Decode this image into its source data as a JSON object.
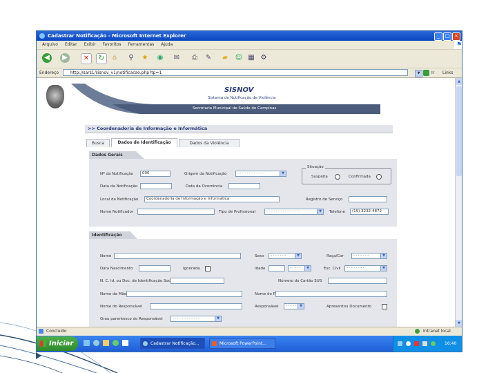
{
  "window": {
    "title": "Cadastrar Notificação - Microsoft Internet Explorer"
  },
  "menu": [
    "Arquivo",
    "Editar",
    "Exibir",
    "Favoritos",
    "Ferramentas",
    "Ajuda"
  ],
  "toolbar": {
    "icons": [
      "back-icon",
      "forward-icon",
      "stop-icon",
      "refresh-icon",
      "home-icon",
      "search-icon",
      "favorites-icon",
      "history-icon",
      "mail-icon",
      "print-icon",
      "edit-icon",
      "folder-icon",
      "messenger-icon",
      "research-icon",
      "tools-icon"
    ]
  },
  "address": {
    "label": "Endereço",
    "url": "http://sars1/sisnov_v1/notificacao.php?tp=1",
    "go_label": "Ir",
    "links_label": "Links"
  },
  "header": {
    "app_name": "SISNOV",
    "subtitle1": "Sistema de Notificação de Violência",
    "subtitle2": "Secretaria Municipal de Saúde de Campinas"
  },
  "page": {
    "section_title": ">> Coordenadoria de Informação e Informática"
  },
  "tabs": [
    "Busca",
    "Dados de Identificação",
    "Dados da Violência"
  ],
  "dados_gerais": {
    "title": "Dados Gerais",
    "n_notificacao_label": "Nº da Notificação",
    "n_notificacao_value": "000",
    "origem_label": "Origem da Notificação",
    "origem_value": "- - - - - - - - - - - -",
    "situacao_label": "Situação",
    "suspeita_label": "Suspeita",
    "confirmada_label": "Confirmada",
    "data_notificacao_label": "Data da Notificação",
    "data_ocorrencia_label": "Data da Ocorrência",
    "local_label": "Local da Notificação",
    "local_value": "Coordenadoria de Informação e Informática",
    "registro_label": "Registro de Serviço",
    "nome_notificador_label": "Nome Notificador",
    "tipo_label": "Tipo de Profissional",
    "tipo_value": "- - - - - - - - - - - - - - -",
    "telefone_label": "Telefone",
    "telefone_value": "(19) 3232-4872"
  },
  "identificacao": {
    "title": "Identificação",
    "nome_label": "Nome",
    "sexo_label": "Sexo",
    "sexo_value": "- - - - - - -",
    "raca_label": "Raça/Cor",
    "raca_value": "- - - - - - -",
    "nascimento_label": "Data Nascimento",
    "ignorada_label": "Ignorada",
    "idade_label": "Idade",
    "idade_unit_value": "- - - - -",
    "escolaridade_label": "Esc. Civil",
    "escolaridade_value": "- - - - - - - -",
    "doc_label": "N. C. Id. ou Doc. de Identificação Social",
    "cartao_sus_label": "Número do Cartão SUS",
    "mae_label": "Nome da Mãe",
    "pai_label": "Nome do Pai",
    "responsavel_label": "Nome do Responsável",
    "responsavel_parent_label": "Responsável",
    "responsavel_parent_value": "- - - - -",
    "apresentou_label": "Apresentou Documento",
    "parentesco_label": "Grau parentesco do Responsável",
    "parentesco_value": "- - - - - - - - - - - -"
  },
  "status": {
    "text": "Concluído",
    "zone": "Intranet local"
  },
  "taskbar": {
    "start_label": "Iniciar",
    "items": [
      "Cadastrar Notificação...",
      "Microsoft PowerPoint..."
    ],
    "clock": "16:40"
  }
}
